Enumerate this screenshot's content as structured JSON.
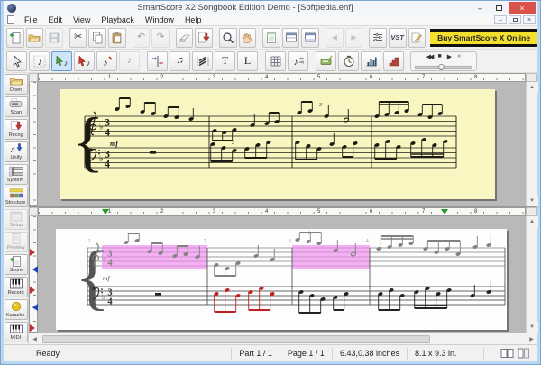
{
  "window": {
    "title": "SmartScore X2 Songbook Edition Demo - [Softpedia.enf]"
  },
  "menu": {
    "items": [
      "File",
      "Edit",
      "View",
      "Playback",
      "Window",
      "Help"
    ]
  },
  "toolbar": {
    "buy_button": "Buy SmartScore X Online",
    "text_tool": "T",
    "lyrics_tool": "L",
    "vst_tool": "VST"
  },
  "glyphs": {
    "cut": "✂",
    "undo": "↶",
    "redo": "↷",
    "prev": "◀",
    "next": "▶",
    "note": "♪",
    "notes": "♫",
    "rewind": "◀◀",
    "stop": "■",
    "play": "▶",
    "record": "●",
    "minimize": "–",
    "close": "×",
    "up": "▲",
    "down": "▼",
    "left": "◀",
    "right": "▶"
  },
  "sidebar": {
    "items": [
      {
        "label": "Open"
      },
      {
        "label": "Scan"
      },
      {
        "label": "Recog"
      },
      {
        "label": "Unify"
      },
      {
        "label": "System"
      },
      {
        "label": "Structure"
      },
      {
        "label": "Setup",
        "disabled": true
      },
      {
        "label": "Preview",
        "disabled": true
      },
      {
        "label": "Score"
      },
      {
        "label": "Record"
      },
      {
        "label": "Karaoke"
      },
      {
        "label": "MIDI"
      }
    ]
  },
  "rulers": {
    "numbers": [
      "1",
      "2",
      "3",
      "4",
      "5",
      "6",
      "7",
      "8"
    ]
  },
  "score": {
    "top": {
      "dynamic": "mf",
      "triplet": "3",
      "time_top": "3",
      "time_bottom": "4"
    },
    "bottom": {
      "dynamic": "mf",
      "triplet": "3",
      "time_top": "3",
      "time_bottom": "4",
      "measure_numbers": [
        "1",
        "2",
        "3",
        "4"
      ]
    }
  },
  "colors": {
    "highlight_pink": "#ee82ee",
    "error_red": "#c22020",
    "recognized_gray": "#818181",
    "page_yellow": "#f9f6c2",
    "buy_yellow": "#f4e02c"
  },
  "statusbar": {
    "ready": "Ready",
    "part": "Part 1 / 1",
    "page": "Page 1 / 1",
    "coords": "6.43,0.38 inches",
    "size": "8.1 x 9.3 in."
  }
}
